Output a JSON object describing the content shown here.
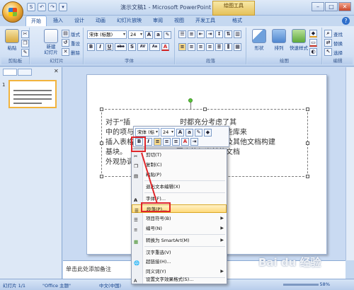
{
  "titlebar": {
    "title": "演示文稿1 - Microsoft PowerPoint",
    "context_tab_label": "绘图工具",
    "qat": [
      "S",
      "↶",
      "↷",
      "▾"
    ]
  },
  "ribbon_tabs": [
    "开始",
    "插入",
    "设计",
    "动画",
    "幻灯片放映",
    "审阅",
    "视图",
    "开发工具",
    "格式"
  ],
  "ribbon": {
    "clipboard": {
      "label": "剪贴板",
      "paste": "粘贴"
    },
    "slides": {
      "label": "幻灯片",
      "new_slide": "新建\n幻灯片",
      "layout": "版式",
      "reset": "重设",
      "delete": "删除"
    },
    "font": {
      "label": "字体",
      "font_name": "宋体 (标题)",
      "font_size": "24",
      "buttons": [
        "B",
        "I",
        "U",
        "abe",
        "S",
        "AV",
        "Aa",
        "A"
      ]
    },
    "paragraph": {
      "label": "段落"
    },
    "drawing": {
      "label": "绘图",
      "shape": "形状",
      "arrange": "排列",
      "quick_styles": "快速样式"
    },
    "editing": {
      "label": "编辑",
      "find": "查找",
      "replace": "替换",
      "select": "选择"
    }
  },
  "slide_panel": {
    "thumb_number": "1"
  },
  "slide": {
    "text_before": "对于“插",
    "text_main": "对于“插                      时都充分考虑了其\n中的项与                      您可以使用这些库来\n插入表格、页眉、页脚、列表、封面以及其他文档构建\n基块。                      图也将与当前的文档\n外观协调"
  },
  "mini_toolbar": {
    "font_name": "宋体 (标题",
    "font_size": "24"
  },
  "context_menu": {
    "items": [
      {
        "label": "剪切(T)",
        "icon": "scissors-icon",
        "submenu": false
      },
      {
        "label": "复制(C)",
        "icon": "copy-icon",
        "submenu": false
      },
      {
        "label": "粘贴(P)",
        "icon": "paste-icon",
        "submenu": false
      },
      {
        "label": "退出文本编辑(X)",
        "icon": "",
        "submenu": false
      },
      {
        "label": "字体(F)...",
        "icon": "font-icon",
        "submenu": false
      },
      {
        "label": "段落(P)...",
        "icon": "paragraph-icon",
        "submenu": false,
        "highlighted": true
      },
      {
        "label": "项目符号(B)",
        "icon": "bullets-icon",
        "submenu": true
      },
      {
        "label": "编号(N)",
        "icon": "numbering-icon",
        "submenu": true
      },
      {
        "label": "转换为 SmartArt(M)",
        "icon": "smartart-icon",
        "submenu": true
      },
      {
        "label": "汉字重选(V)",
        "icon": "",
        "submenu": false
      },
      {
        "label": "超链接(H)...",
        "icon": "hyperlink-icon",
        "submenu": false
      },
      {
        "label": "同义词(Y)",
        "icon": "",
        "submenu": true
      },
      {
        "label": "设置文字效果格式(S)...",
        "icon": "text-effect-icon",
        "submenu": false
      }
    ]
  },
  "notes": {
    "placeholder": "单击此处添加备注"
  },
  "statusbar": {
    "slide_info": "幻灯片 1/1",
    "theme": "\"Office 主题\"",
    "language": "中文(中国)",
    "zoom": "58%"
  },
  "watermark": "Bai du 经验",
  "colors": {
    "accent": "#f2b33d",
    "annotation": "#e0262a",
    "ribbon": "#d2e1f5"
  }
}
